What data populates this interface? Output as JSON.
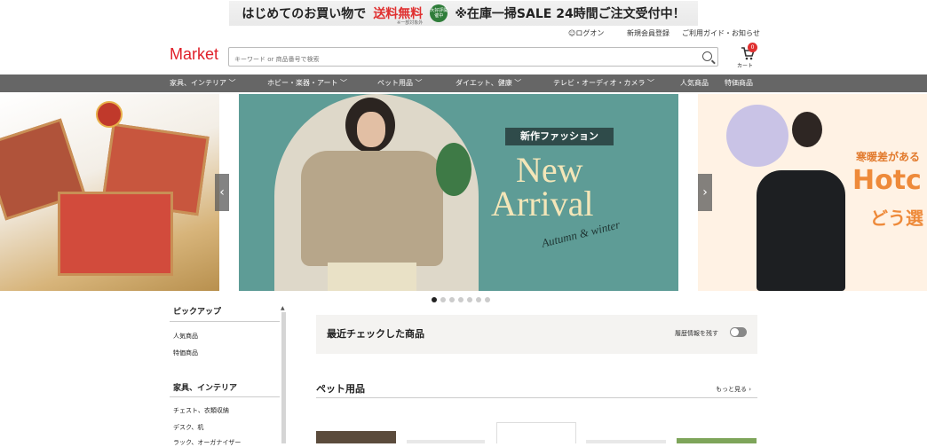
{
  "promo": {
    "text1": "はじめてのお買い物で",
    "text2": "送料無料",
    "sub": "※一部対象外",
    "badge": "大好評開催中",
    "text3": "※在庫一掃SALE 24時間ご注文受付中！"
  },
  "toplinks": {
    "login": "ログオン",
    "register": "新規会員登録",
    "guide": "ご利用ガイド・お知らせ"
  },
  "header": {
    "logo": "Market",
    "search_placeholder": "キーワード or 商品番号で検索",
    "cart_count": "0",
    "cart_label": "カート"
  },
  "nav": [
    {
      "label": "家具、インテリア ﹀"
    },
    {
      "label": "ホビー・楽器・アート ﹀"
    },
    {
      "label": "ペット用品 ﹀"
    },
    {
      "label": "ダイエット、健康 ﹀"
    },
    {
      "label": "テレビ・オーディオ・カメラ ﹀"
    },
    {
      "label": "人気商品"
    },
    {
      "label": "特価商品"
    }
  ],
  "carousel": {
    "center_tag": "新作ファッション",
    "center_title1": "New",
    "center_title2": "Arrival",
    "center_script": "Autumn & winter",
    "right_text1": "寒暖差がある",
    "right_text2": "Hotc",
    "right_text3": "どう選",
    "prev": "‹",
    "next": "›",
    "dot_count": 7,
    "active_dot": 0
  },
  "sidebar": {
    "section1": "ピックアップ",
    "items1": [
      "人気商品",
      "特価商品"
    ],
    "section2": "家具、インテリア",
    "items2": [
      "チェスト、衣類収納",
      "デスク、机",
      "ラック、オーガナイザー"
    ]
  },
  "recent": {
    "title": "最近チェックした商品",
    "toggle_label": "履歴情報を残す"
  },
  "pet": {
    "title": "ペット用品",
    "more": "もっと見る ›"
  },
  "colors": {
    "accent": "#e0202a",
    "nav_bg": "#666666",
    "banner_teal": "#5e9c96"
  }
}
